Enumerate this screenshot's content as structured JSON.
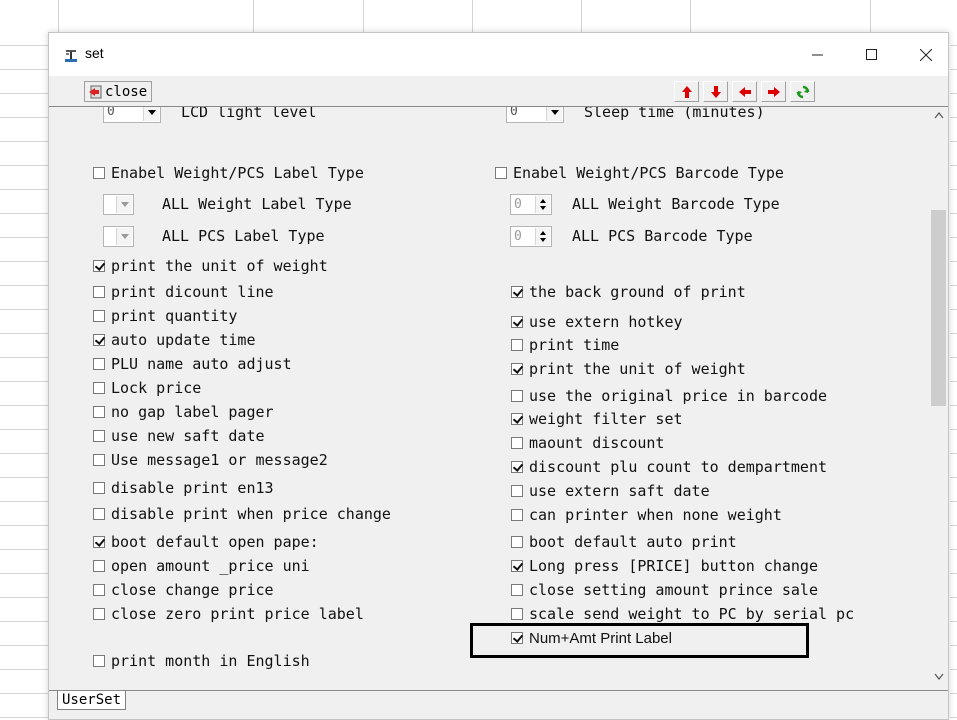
{
  "window": {
    "title": "set"
  },
  "toolbar": {
    "close_label": "close"
  },
  "top_row": {
    "lcd_value": "0",
    "lcd_label": "LCD light level",
    "sleep_value": "0",
    "sleep_label": "Sleep time (minutes)"
  },
  "left_section": {
    "enable_label_type": {
      "label": "Enabel Weight/PCS Label Type",
      "checked": false
    },
    "all_weight_label": "ALL Weight Label Type",
    "all_pcs_label": "ALL PCS Label Type"
  },
  "right_section": {
    "enable_barcode_type": {
      "label": "Enabel Weight/PCS Barcode Type",
      "checked": false
    },
    "weight_barcode_value": "0",
    "all_weight_barcode": "ALL Weight Barcode Type",
    "pcs_barcode_value": "0",
    "all_pcs_barcode": "ALL PCS Barcode Type"
  },
  "left_options": [
    {
      "label": "print the unit of weight",
      "checked": true
    },
    {
      "label": "print dicount line",
      "checked": false
    },
    {
      "label": "print quantity",
      "checked": false
    },
    {
      "label": "auto update time",
      "checked": true
    },
    {
      "label": "PLU name auto adjust",
      "checked": false
    },
    {
      "label": "Lock price",
      "checked": false
    },
    {
      "label": "no gap label pager",
      "checked": false
    },
    {
      "label": "use new saft date",
      "checked": false
    },
    {
      "label": "Use message1 or message2",
      "checked": false
    },
    {
      "label": "disable print en13",
      "checked": false
    },
    {
      "label": "disable print when price change",
      "checked": false
    },
    {
      "label": "boot default open pape:",
      "checked": true
    },
    {
      "label": "open amount _price uni",
      "checked": false
    },
    {
      "label": "close change price",
      "checked": false
    },
    {
      "label": "close zero print price label",
      "checked": false
    },
    {
      "label": "print month in English",
      "checked": false
    }
  ],
  "right_options": [
    {
      "label": "the back ground of print",
      "checked": true
    },
    {
      "label": "use extern hotkey",
      "checked": true
    },
    {
      "label": "print time",
      "checked": false
    },
    {
      "label": "print the unit of weight",
      "checked": true
    },
    {
      "label": "use the original price in barcode",
      "checked": false
    },
    {
      "label": "weight filter set",
      "checked": true
    },
    {
      "label": "maount discount",
      "checked": false
    },
    {
      "label": "discount plu count to dempartment",
      "checked": true
    },
    {
      "label": "use extern saft date",
      "checked": false
    },
    {
      "label": "can printer when none weight",
      "checked": false
    },
    {
      "label": "boot default auto print",
      "checked": false
    },
    {
      "label": "Long press [PRICE] button change",
      "checked": true
    },
    {
      "label": "close setting amount prince sale",
      "checked": false
    },
    {
      "label": "scale send weight to PC by serial pc",
      "checked": false
    },
    {
      "label": "Num+Amt Print Label",
      "checked": true
    }
  ],
  "tabs": [
    {
      "label": "UserSet"
    }
  ]
}
